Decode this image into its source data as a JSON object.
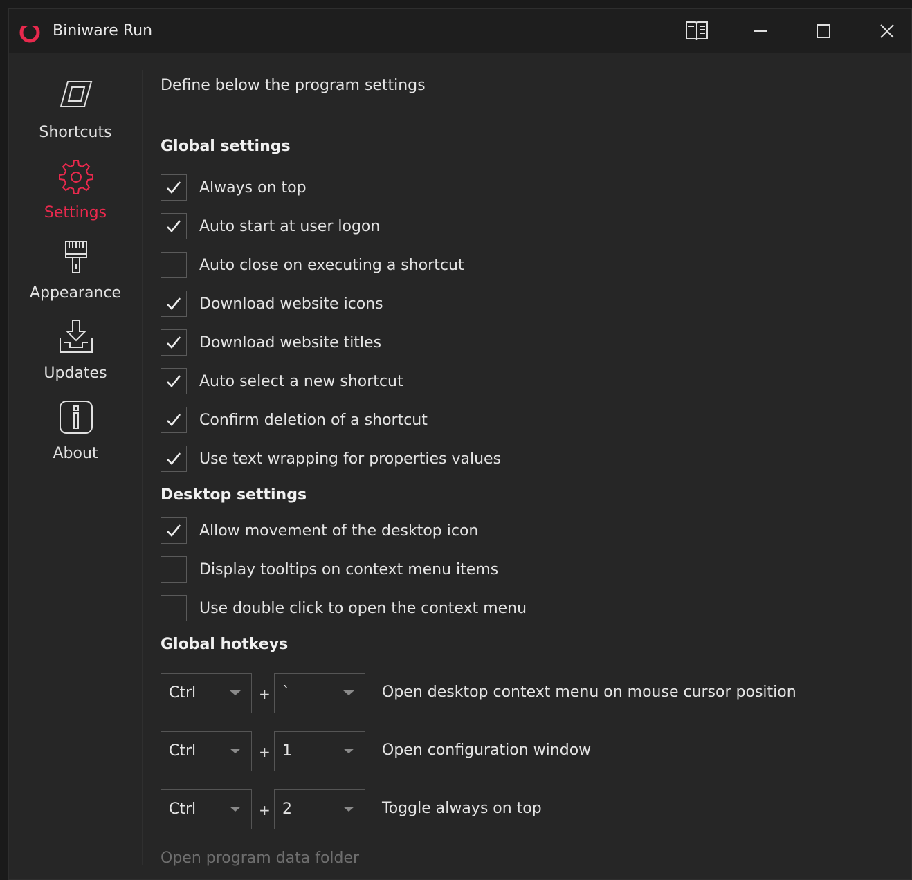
{
  "window": {
    "title": "Biniware Run"
  },
  "sidebar": {
    "items": [
      {
        "label": "Shortcuts",
        "icon": "shortcuts-icon",
        "active": false
      },
      {
        "label": "Settings",
        "icon": "gear-icon",
        "active": true
      },
      {
        "label": "Appearance",
        "icon": "brush-icon",
        "active": false
      },
      {
        "label": "Updates",
        "icon": "download-icon",
        "active": false
      },
      {
        "label": "About",
        "icon": "info-icon",
        "active": false
      }
    ]
  },
  "main": {
    "intro": "Define below the program settings",
    "global": {
      "title": "Global settings",
      "options": [
        {
          "label": "Always on top",
          "checked": true
        },
        {
          "label": "Auto start at user logon",
          "checked": true
        },
        {
          "label": "Auto close on executing a shortcut",
          "checked": false
        },
        {
          "label": "Download website icons",
          "checked": true
        },
        {
          "label": "Download website titles",
          "checked": true
        },
        {
          "label": "Auto select a new shortcut",
          "checked": true
        },
        {
          "label": "Confirm deletion of a shortcut",
          "checked": true
        },
        {
          "label": "Use text wrapping for properties values",
          "checked": true
        }
      ]
    },
    "desktop": {
      "title": "Desktop settings",
      "options": [
        {
          "label": "Allow movement of the desktop icon",
          "checked": true
        },
        {
          "label": "Display tooltips on context menu items",
          "checked": false
        },
        {
          "label": "Use double click to open the context menu",
          "checked": false
        }
      ]
    },
    "hotkeys": {
      "title": "Global hotkeys",
      "plus": "+",
      "rows": [
        {
          "modifier": "Ctrl",
          "key": "`",
          "description": "Open desktop context menu on mouse cursor position"
        },
        {
          "modifier": "Ctrl",
          "key": "1",
          "description": "Open configuration window"
        },
        {
          "modifier": "Ctrl",
          "key": "2",
          "description": "Toggle always on top"
        }
      ]
    },
    "open_folder_link": "Open program data folder"
  },
  "colors": {
    "accent": "#e8294d",
    "background": "#262626",
    "titlebar": "#1e1e1e"
  }
}
